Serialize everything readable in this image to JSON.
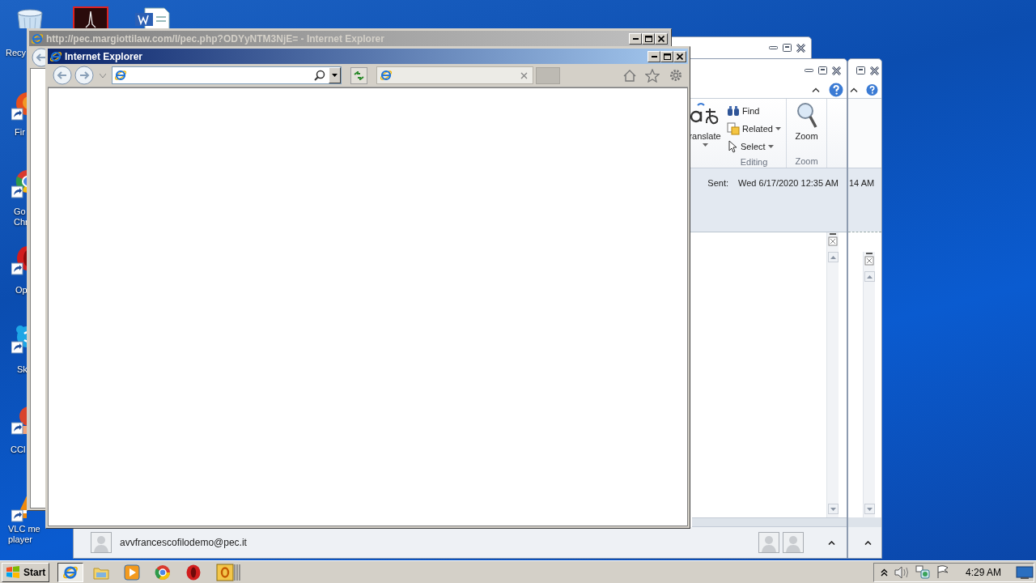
{
  "desktop_icons": [
    {
      "kind": "recycle-bin",
      "label": [
        "Recy"
      ]
    },
    {
      "kind": "pdf"
    },
    {
      "kind": "word"
    },
    {
      "kind": "firefox",
      "label": [
        "Fir"
      ]
    },
    {
      "kind": "chrome",
      "label": [
        "Go",
        "Chr"
      ]
    },
    {
      "kind": "opera",
      "label": [
        "Op"
      ]
    },
    {
      "kind": "skype",
      "label": [
        "Sk"
      ]
    },
    {
      "kind": "ccleaner",
      "label": [
        "CCl"
      ]
    },
    {
      "kind": "vlc",
      "label": [
        "VLC me",
        "player"
      ]
    }
  ],
  "mail_window_back": {
    "time": "14 AM"
  },
  "mail_window": {
    "ribbon": {
      "translate": "ranslate",
      "editing": {
        "commands": [
          {
            "kind": "find",
            "label": "Find",
            "dropdown": false
          },
          {
            "kind": "related",
            "label": "Related",
            "dropdown": true
          },
          {
            "kind": "select",
            "label": "Select",
            "dropdown": true
          }
        ],
        "label": "Editing"
      },
      "zoom": {
        "button": "Zoom",
        "label": "Zoom"
      }
    },
    "header": {
      "sent_label": "Sent:",
      "sent_value": "Wed 6/17/2020 12:35 AM"
    },
    "people_pane": {
      "sender": "avvfrancescofilodemo@pec.it"
    }
  },
  "browser_windows": [
    {
      "title": "http://pec.margiottilaw.com/l/pec.php?ODYyNTM3NjE= - Internet Explorer",
      "active": false
    },
    {
      "title": "Internet Explorer",
      "active": true
    }
  ],
  "taskbar": {
    "start": "Start",
    "apps": [
      {
        "kind": "ie",
        "selected": true
      },
      {
        "kind": "explorer",
        "selected": false
      },
      {
        "kind": "media-player",
        "selected": false
      },
      {
        "kind": "chrome",
        "selected": false
      },
      {
        "kind": "opera",
        "selected": false
      },
      {
        "kind": "outlook",
        "selected": false
      }
    ],
    "clock": "4:29 AM"
  }
}
